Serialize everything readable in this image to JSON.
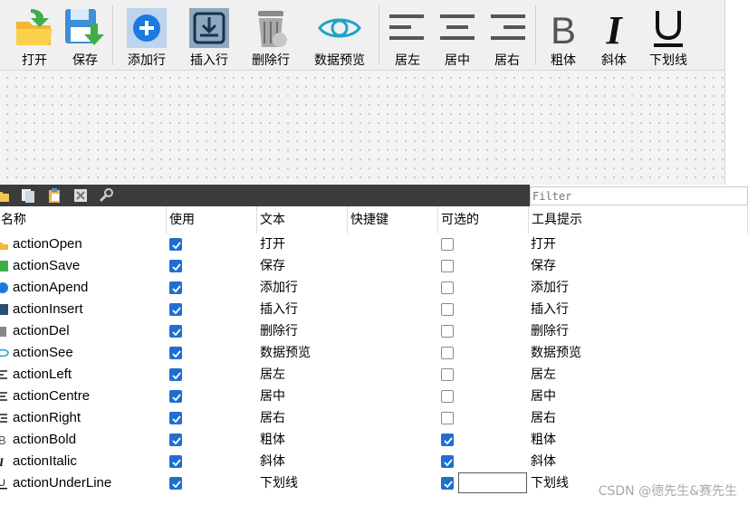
{
  "toolbar": {
    "buttons": [
      {
        "label": "打开",
        "icon": "open-folder-icon"
      },
      {
        "label": "保存",
        "icon": "save-floppy-icon"
      },
      {
        "label": "添加行",
        "icon": "add-circle-icon"
      },
      {
        "label": "插入行",
        "icon": "insert-download-icon"
      },
      {
        "label": "删除行",
        "icon": "trash-bin-icon"
      },
      {
        "label": "数据预览",
        "icon": "eye-icon"
      },
      {
        "label": "居左",
        "icon": "align-left-icon"
      },
      {
        "label": "居中",
        "icon": "align-center-icon"
      },
      {
        "label": "居右",
        "icon": "align-right-icon"
      },
      {
        "label": "粗体",
        "icon": "bold-icon"
      },
      {
        "label": "斜体",
        "icon": "italic-icon"
      },
      {
        "label": "下划线",
        "icon": "underline-icon"
      }
    ]
  },
  "action_editor": {
    "tools": [
      "new-action-icon",
      "copy-action-icon",
      "paste-action-icon",
      "delete-action-icon",
      "configure-wrench-icon"
    ],
    "filter_placeholder": "Filter",
    "columns": [
      "名称",
      "使用",
      "文本",
      "快捷键",
      "可选的",
      "工具提示"
    ],
    "rows": [
      {
        "name": "actionOpen",
        "used": true,
        "text": "打开",
        "shortcut": "",
        "checkable": false,
        "tooltip": "打开"
      },
      {
        "name": "actionSave",
        "used": true,
        "text": "保存",
        "shortcut": "",
        "checkable": false,
        "tooltip": "保存"
      },
      {
        "name": "actionApend",
        "used": true,
        "text": "添加行",
        "shortcut": "",
        "checkable": false,
        "tooltip": "添加行"
      },
      {
        "name": "actionInsert",
        "used": true,
        "text": "插入行",
        "shortcut": "",
        "checkable": false,
        "tooltip": "插入行"
      },
      {
        "name": "actionDel",
        "used": true,
        "text": "删除行",
        "shortcut": "",
        "checkable": false,
        "tooltip": "删除行"
      },
      {
        "name": "actionSee",
        "used": true,
        "text": "数据预览",
        "shortcut": "",
        "checkable": false,
        "tooltip": "数据预览"
      },
      {
        "name": "actionLeft",
        "used": true,
        "text": "居左",
        "shortcut": "",
        "checkable": false,
        "tooltip": "居左"
      },
      {
        "name": "actionCentre",
        "used": true,
        "text": "居中",
        "shortcut": "",
        "checkable": false,
        "tooltip": "居中"
      },
      {
        "name": "actionRight",
        "used": true,
        "text": "居右",
        "shortcut": "",
        "checkable": false,
        "tooltip": "居右"
      },
      {
        "name": "actionBold",
        "used": true,
        "text": "粗体",
        "shortcut": "",
        "checkable": true,
        "tooltip": "粗体"
      },
      {
        "name": "actionItalic",
        "used": true,
        "text": "斜体",
        "shortcut": "",
        "checkable": true,
        "tooltip": "斜体"
      },
      {
        "name": "actionUnderLine",
        "used": true,
        "text": "下划线",
        "shortcut": "",
        "checkable": true,
        "tooltip": "下划线"
      }
    ]
  },
  "watermark": "CSDN @德先生&赛先生",
  "colors": {
    "checkbox_on": "#1e6fd0",
    "toolbar_bg": "#f0f0f0",
    "action_bar_bg": "#3c3c3c"
  }
}
